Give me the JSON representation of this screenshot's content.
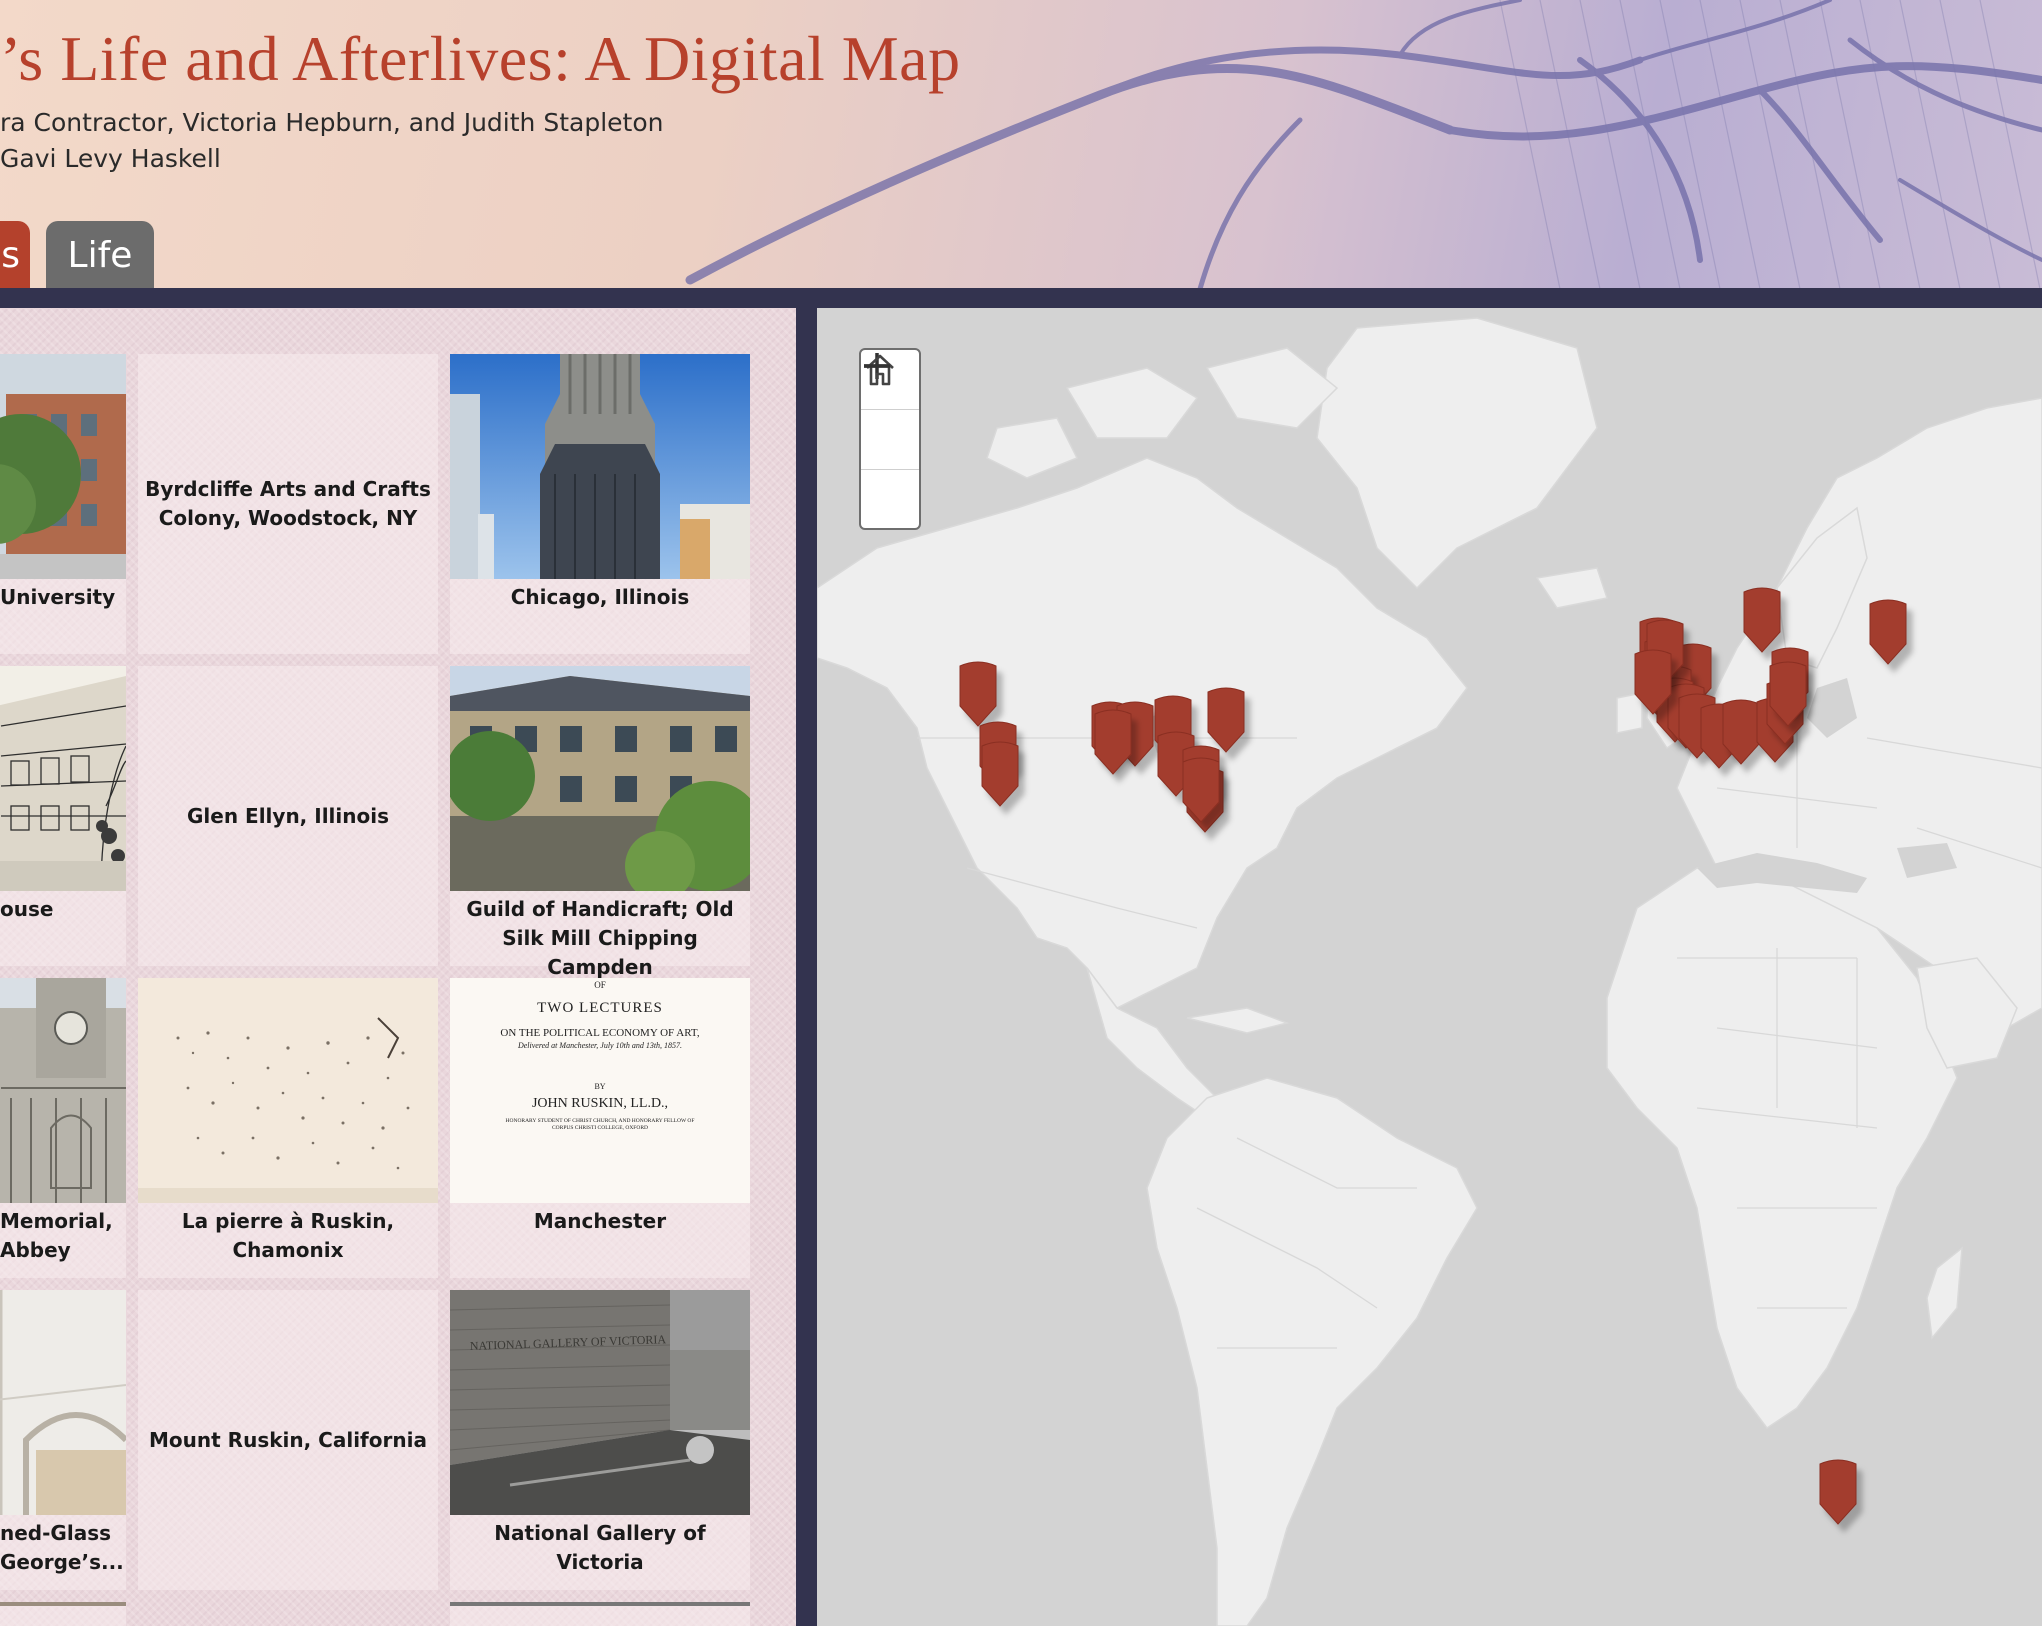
{
  "header": {
    "title": "’s Life and Afterlives: A Digital Map",
    "byline_authors": "ra Contractor, Victoria Hepburn, and Judith Stapleton",
    "byline_design": "Gavi Levy Haskell",
    "tabs": [
      {
        "label": "s",
        "active": true
      },
      {
        "label": "Life",
        "active": false
      }
    ]
  },
  "gallery": {
    "items": [
      {
        "label": "University",
        "has_image": true
      },
      {
        "label": "Byrdcliffe Arts and Crafts Colony, Woodstock, NY",
        "has_image": false
      },
      {
        "label": "Chicago, Illinois",
        "has_image": true
      },
      {
        "label": "ouse",
        "has_image": true
      },
      {
        "label": "Glen Ellyn, Illinois",
        "has_image": false
      },
      {
        "label": "Guild of Handicraft; Old Silk Mill Chipping Campden",
        "has_image": true
      },
      {
        "label": "Memorial,\n Abbey",
        "has_image": true
      },
      {
        "label": "La pierre à Ruskin, Chamonix",
        "has_image": true
      },
      {
        "label": "Manchester",
        "has_image": true
      },
      {
        "label": "ned-Glass\nGeorge’s...",
        "has_image": true
      },
      {
        "label": "Mount Ruskin, California",
        "has_image": false
      },
      {
        "label": "National Gallery of Victoria",
        "has_image": true
      }
    ],
    "thumbnail_text": {
      "lecture_of": "OF",
      "lecture_title": "TWO LECTURES",
      "lecture_subtitle": "ON THE POLITICAL ECONOMY OF ART,",
      "lecture_delivered": "Delivered at Manchester, July 10th and 13th, 1857.",
      "lecture_by": "BY",
      "lecture_author": "JOHN RUSKIN, LL.D.,",
      "lecture_credit_1": "HONORARY STUDENT OF CHRIST CHURCH, AND HONORARY FELLOW OF",
      "lecture_credit_2": "CORPUS CHRISTI COLLEGE, OXFORD",
      "gallery_wall_text": "NATIONAL GALLERY OF VICTORIA"
    }
  },
  "map": {
    "controls": {
      "zoom_in_icon": "plus-icon",
      "home_icon": "home-icon",
      "zoom_out_icon": "minus-icon"
    },
    "colors": {
      "land": "#eeeeee",
      "water": "#d3d3d3",
      "marker": "#a33d2e",
      "title": "#b7412c"
    },
    "marker_count": 31
  }
}
